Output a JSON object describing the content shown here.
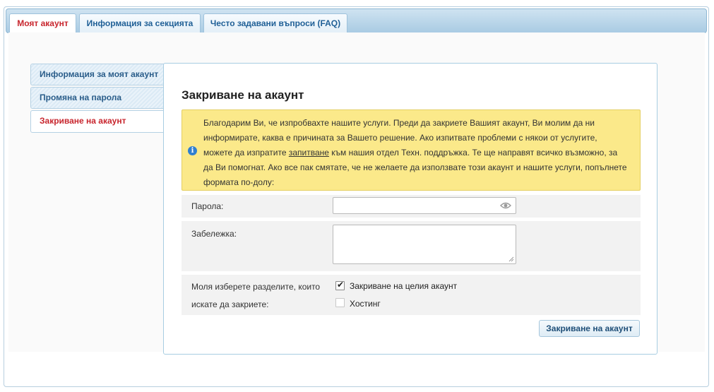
{
  "tabs": [
    {
      "label": "Моят акаунт"
    },
    {
      "label": "Информация за секцията"
    },
    {
      "label": "Често задавани въпроси (FAQ)"
    }
  ],
  "sidebar": {
    "items": [
      {
        "label": "Информация за моят акаунт"
      },
      {
        "label": "Промяна на парола"
      },
      {
        "label": "Закриване на акаунт"
      }
    ]
  },
  "panel": {
    "title": "Закриване на акаунт",
    "notice": {
      "text_before_link": "Благодарим Ви, че изпробвахте нашите услуги. Преди да закриете Вашият акаунт, Ви молим да ни информирате, каква е причината за Вашето решение. Ако изпитвате проблеми с някои от услугите, можете да изпратите ",
      "link": "запитване",
      "text_after_link": " към нашия отдел Техн. поддръжка. Те ще направят всичко възможно, за да Ви помогнат. Ако все пак смятате, че не желаете да използвате този акаунт и нашите услуги, попълнете формата по-долу:"
    },
    "password_label": "Парола:",
    "password_value": "",
    "note_label": "Забележка:",
    "note_value": "",
    "sections_label": "Моля изберете разделите, които искате да закриете:",
    "options": [
      {
        "label": "Закриване на целия акаунт",
        "checked": true
      },
      {
        "label": "Хостинг",
        "checked": false
      }
    ],
    "submit_label": "Закриване на акаунт"
  },
  "colors": {
    "active_tab_text": "#c8262e",
    "link_blue": "#1f5f96",
    "notice_bg": "#fbe98a"
  }
}
